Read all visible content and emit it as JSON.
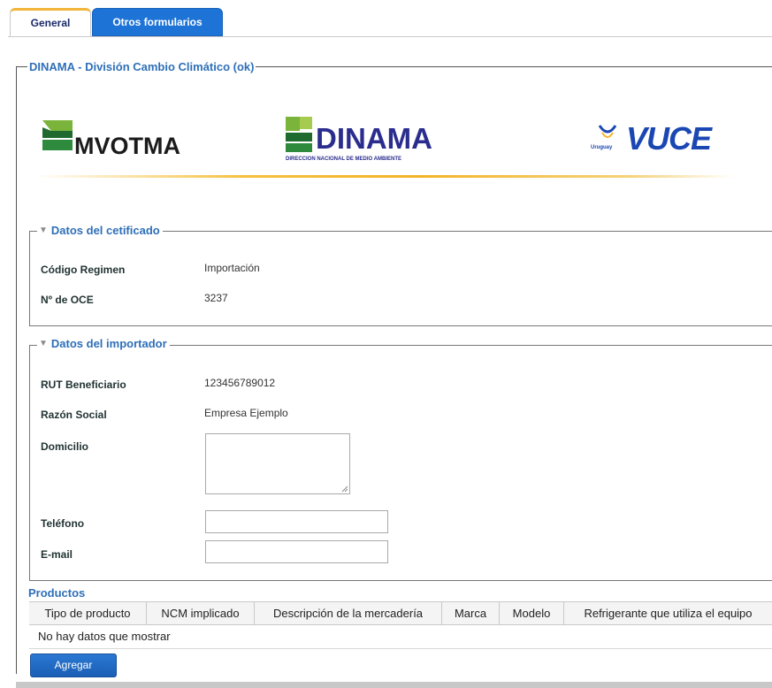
{
  "tabs": [
    {
      "label": "General"
    },
    {
      "label": "Otros formularios"
    }
  ],
  "form": {
    "title": "DINAMA - División Cambio Climático (ok)"
  },
  "logos": {
    "mvotma": "MVOTMA",
    "dinama": "DINAMA",
    "dinama_sub": "DIRECCION NACIONAL DE MEDIO AMBIENTE",
    "vuce": "VUCE",
    "vuce_sub": "Uruguay"
  },
  "certificado": {
    "title": "Datos del cetificado",
    "fields": [
      {
        "label": "Código Regimen",
        "value": "Importación"
      },
      {
        "label": "Nº de OCE",
        "value": "3237"
      }
    ]
  },
  "importador": {
    "title": "Datos del importador",
    "rut_label": "RUT Beneficiario",
    "rut_value": "123456789012",
    "razon_label": "Razón Social",
    "razon_value": "Empresa Ejemplo",
    "domicilio_label": "Domicilio",
    "domicilio_value": "",
    "telefono_label": "Teléfono",
    "telefono_value": "",
    "email_label": "E-mail",
    "email_value": ""
  },
  "productos": {
    "title": "Productos",
    "columns": [
      "Tipo de producto",
      "NCM implicado",
      "Descripción de la mercadería",
      "Marca",
      "Modelo",
      "Refrigerante que utiliza el equipo"
    ],
    "empty_text": "No hay datos que mostrar",
    "add_label": "Agregar"
  },
  "colors": {
    "accent": "#1d73d6",
    "section_title": "#2e6fb8",
    "tab_active_border": "#f0b53a"
  }
}
